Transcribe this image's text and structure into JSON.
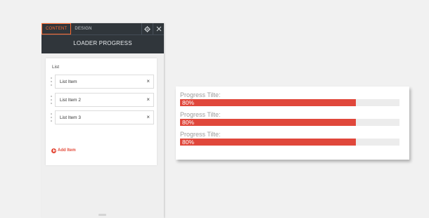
{
  "editor": {
    "tabs": [
      {
        "label": "CONTENT",
        "active": true
      },
      {
        "label": "DESIGN",
        "active": false
      }
    ],
    "header_icons": [
      "gear-icon",
      "close-icon"
    ],
    "title": "LOADER PROGRESS",
    "list": {
      "label": "List",
      "items": [
        {
          "label": "List Item"
        },
        {
          "label": "List Item 2"
        },
        {
          "label": "List Item 3"
        }
      ],
      "add_label": "Add Item"
    }
  },
  "preview": {
    "bars": [
      {
        "title": "Progress Tilte:",
        "percent_label": "80%",
        "value": 0.8
      },
      {
        "title": "Progress Tilte:",
        "percent_label": "80%",
        "value": 0.8
      },
      {
        "title": "Progress Tilte:",
        "percent_label": "80%",
        "value": 0.8
      }
    ]
  },
  "colors": {
    "accent": "#ff6a2f",
    "bar_fill": "#e0473b",
    "bar_track": "#ececec",
    "panel_header": "#30363b"
  }
}
